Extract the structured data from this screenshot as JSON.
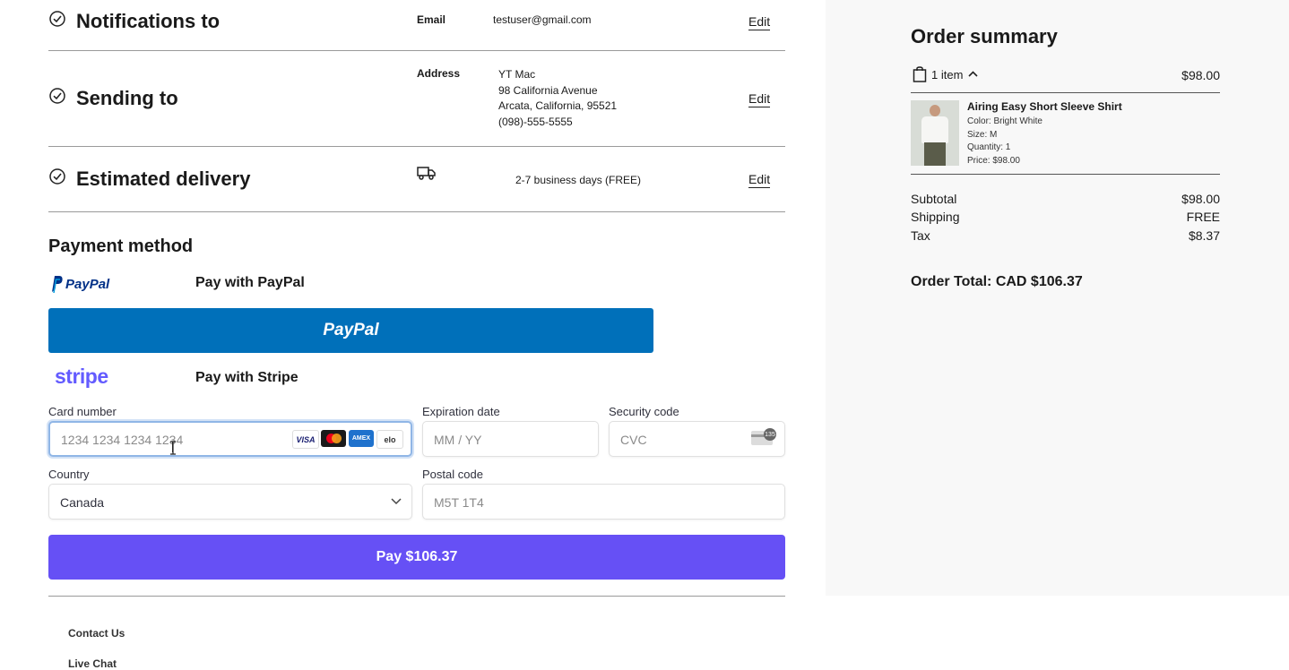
{
  "steps": {
    "notifications": {
      "title": "Notifications to",
      "field_label": "Email",
      "value": "testuser@gmail.com",
      "edit": "Edit"
    },
    "sending": {
      "title": "Sending to",
      "field_label": "Address",
      "lines": [
        "YT Mac",
        "98 California Avenue",
        "Arcata, California, 95521",
        "(098)-555-5555"
      ],
      "edit": "Edit"
    },
    "delivery": {
      "title": "Estimated delivery",
      "icon": "truck-icon",
      "value": "2-7 business days (FREE)",
      "edit": "Edit"
    }
  },
  "payment": {
    "title": "Payment method",
    "paypal": {
      "logo_text": "PayPal",
      "label": "Pay with PayPal",
      "button_text": "PayPal"
    },
    "stripe": {
      "logo_text": "stripe",
      "label": "Pay with Stripe"
    },
    "card_number": {
      "label": "Card number",
      "placeholder": "1234 1234 1234 1234",
      "brands": [
        "VISA",
        "mastercard",
        "AMEX",
        "elo"
      ]
    },
    "expiration": {
      "label": "Expiration date",
      "placeholder": "MM / YY"
    },
    "security": {
      "label": "Security code",
      "placeholder": "CVC",
      "badge": "135"
    },
    "country": {
      "label": "Country",
      "value": "Canada"
    },
    "postal": {
      "label": "Postal code",
      "placeholder": "M5T 1T4"
    },
    "pay_button": "Pay $106.37"
  },
  "footer": {
    "links": [
      "Contact Us",
      "Live Chat"
    ]
  },
  "summary": {
    "title": "Order summary",
    "items_count": "1 item",
    "items_total": "$98.00",
    "product": {
      "name": "Airing Easy Short Sleeve Shirt",
      "color": "Color: Bright White",
      "size": "Size: M",
      "quantity": "Quantity: 1",
      "price": "Price: $98.00"
    },
    "rows": [
      {
        "label": "Subtotal",
        "value": "$98.00"
      },
      {
        "label": "Shipping",
        "value": "FREE"
      },
      {
        "label": "Tax",
        "value": "$8.37"
      }
    ],
    "order_total": "Order Total: CAD $106.37"
  },
  "colors": {
    "paypal_blue": "#0070ba",
    "stripe_purple": "#6650f5",
    "sidebar_bg": "#f8f8f8"
  }
}
